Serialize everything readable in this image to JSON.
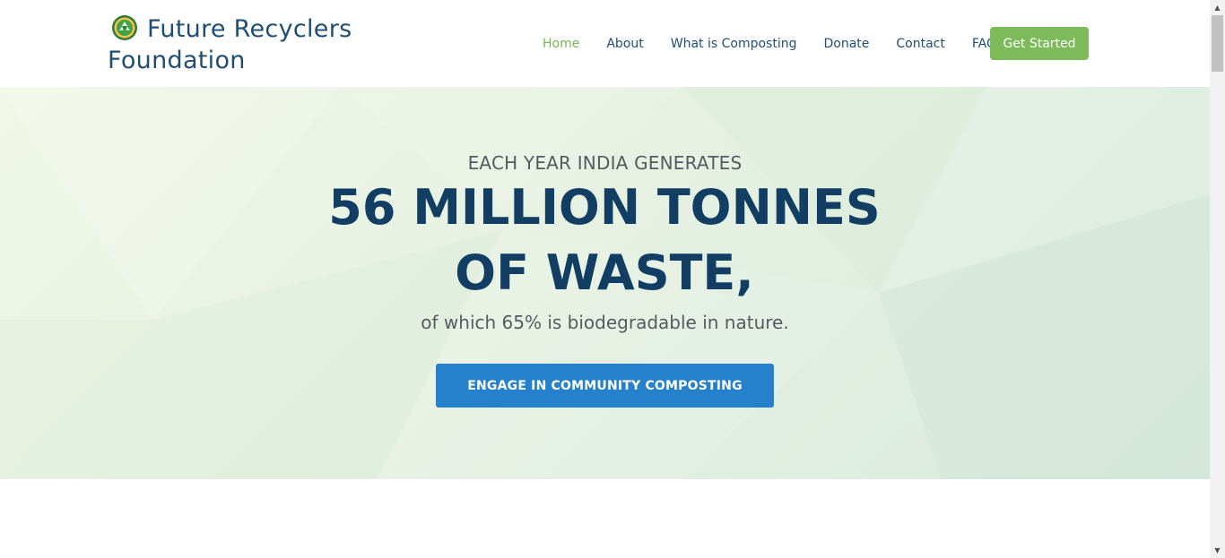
{
  "brand": {
    "line1": "Future Recyclers",
    "line2": "Foundation",
    "logo_icon": "recycle-emblem-icon",
    "color": "#1f4e73"
  },
  "nav": {
    "items": [
      {
        "label": "Home",
        "active": true
      },
      {
        "label": "About",
        "active": false
      },
      {
        "label": "What is Composting",
        "active": false
      },
      {
        "label": "Donate",
        "active": false
      },
      {
        "label": "Contact",
        "active": false
      },
      {
        "label": "FAQ",
        "active": false
      }
    ],
    "cta_label": "Get Started"
  },
  "hero": {
    "eyebrow": "EACH YEAR INDIA GENERATES",
    "title": "56 MILLION TONNES OF WASTE,",
    "subtitle": "of which 65% is biodegradable in nature.",
    "cta_label": "ENGAGE IN COMMUNITY COMPOSTING"
  },
  "colors": {
    "accent_green": "#7dba59",
    "nav_active": "#76b852",
    "cta_blue": "#2681cc",
    "title_navy": "#123e63"
  },
  "scrollbar": {
    "up_icon": "scroll-up-arrow-icon",
    "down_icon": "scroll-down-arrow-icon"
  }
}
